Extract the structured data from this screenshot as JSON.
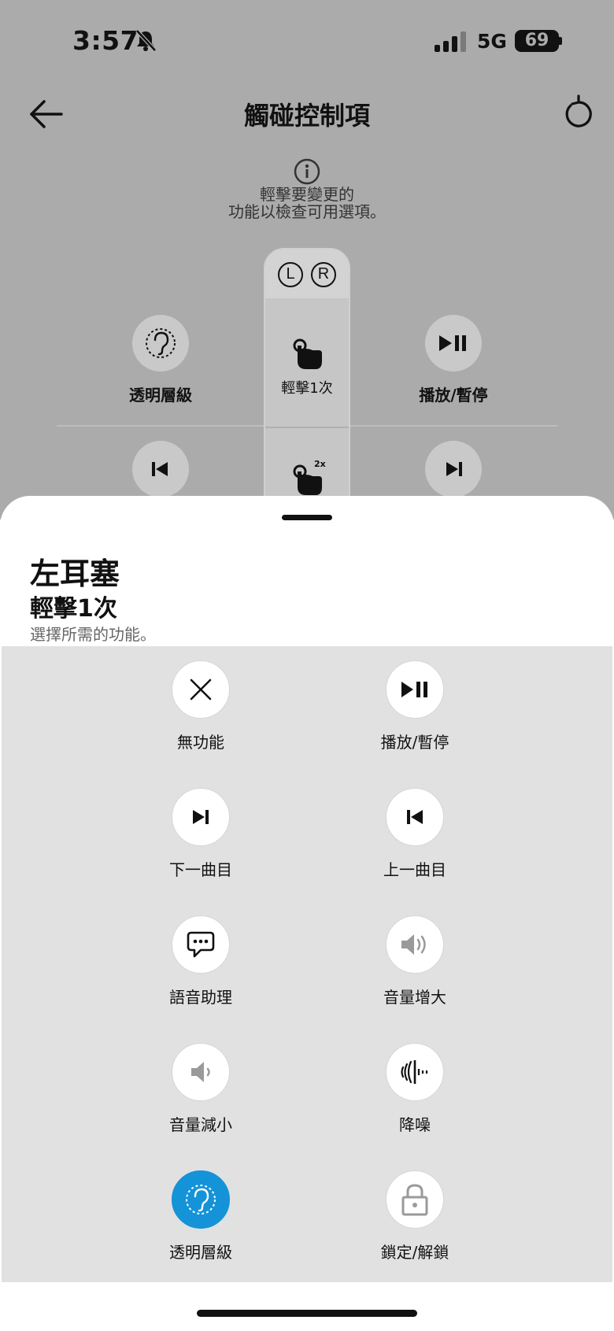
{
  "status_bar": {
    "time": "3:57",
    "network": "5G",
    "battery": "69"
  },
  "header": {
    "title": "觸碰控制項",
    "back_icon": "arrow-left-icon",
    "reset_icon": "refresh-icon"
  },
  "info": {
    "icon": "info-icon",
    "text": "輕擊要變更的\n功能以檢查可用選項。"
  },
  "earbud_column": {
    "left_badge": "L",
    "right_badge": "R",
    "gestures": [
      {
        "label": "輕擊1次",
        "icon": "tap-hand-icon"
      },
      {
        "label": "",
        "icon": "double-tap-hand-icon",
        "badge": "2x"
      }
    ]
  },
  "background_actions": {
    "row1_left": {
      "label": "透明層級",
      "icon": "ear-icon"
    },
    "row1_right": {
      "label": "播放/暫停",
      "icon": "play-pause-icon"
    },
    "row2_left": {
      "label": "",
      "icon": "previous-track-icon"
    },
    "row2_right": {
      "label": "",
      "icon": "next-track-icon"
    }
  },
  "sheet": {
    "title": "左耳塞",
    "subtitle": "輕擊1次",
    "hint": "選擇所需的功能。",
    "options": [
      {
        "label": "無功能",
        "icon": "close-icon",
        "selected": false
      },
      {
        "label": "播放/暫停",
        "icon": "play-pause-icon",
        "selected": false
      },
      {
        "label": "下一曲目",
        "icon": "next-track-icon",
        "selected": false
      },
      {
        "label": "上一曲目",
        "icon": "previous-track-icon",
        "selected": false
      },
      {
        "label": "語音助理",
        "icon": "chat-bubble-icon",
        "selected": false
      },
      {
        "label": "音量增大",
        "icon": "volume-up-icon",
        "selected": false
      },
      {
        "label": "音量減小",
        "icon": "volume-down-icon",
        "selected": false
      },
      {
        "label": "降噪",
        "icon": "noise-cancel-icon",
        "selected": false
      },
      {
        "label": "透明層級",
        "icon": "ear-icon",
        "selected": true
      },
      {
        "label": "鎖定/解鎖",
        "icon": "lock-icon",
        "selected": false
      }
    ]
  },
  "colors": {
    "accent": "#1493d8",
    "dim_background": "#ababab",
    "options_background": "#e1e1e1"
  }
}
